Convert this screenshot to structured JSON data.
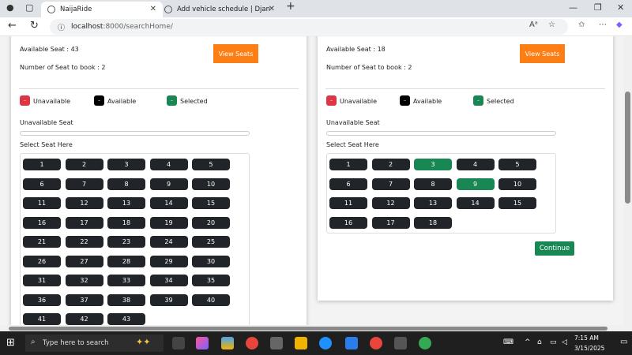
{
  "browser": {
    "tabs": [
      {
        "title": "NaijaRide"
      },
      {
        "title": "Add vehicle schedule | Django sit"
      }
    ],
    "url_host": "localhost",
    "url_path": ":8000/searchHome/"
  },
  "left_card": {
    "available_seat": "Available Seat : 43",
    "number_to_book": "Number of Seat to book : 2",
    "view_button": "View Seats",
    "legend": {
      "unavailable": "Unavailable",
      "available": "Available",
      "selected": "Selected"
    },
    "unavailable_label": "Unavailable Seat",
    "select_label": "Select Seat Here",
    "seats": [
      "1",
      "2",
      "3",
      "4",
      "5",
      "6",
      "7",
      "8",
      "9",
      "10",
      "11",
      "12",
      "13",
      "14",
      "15",
      "16",
      "17",
      "18",
      "19",
      "20",
      "21",
      "22",
      "23",
      "24",
      "25",
      "26",
      "27",
      "28",
      "29",
      "30",
      "31",
      "32",
      "33",
      "34",
      "35",
      "36",
      "37",
      "38",
      "39",
      "40",
      "41",
      "42",
      "43"
    ],
    "selected": []
  },
  "right_card": {
    "available_seat": "Available Seat : 18",
    "number_to_book": "Number of Seat to book : 2",
    "view_button": "View Seats",
    "legend": {
      "unavailable": "Unavailable",
      "available": "Available",
      "selected": "Selected"
    },
    "unavailable_label": "Unavailable Seat",
    "select_label": "Select Seat Here",
    "seats": [
      "1",
      "2",
      "3",
      "4",
      "5",
      "6",
      "7",
      "8",
      "9",
      "10",
      "11",
      "12",
      "13",
      "14",
      "15",
      "16",
      "17",
      "18"
    ],
    "selected": [
      "3",
      "9"
    ],
    "continue_button": "Continue"
  },
  "colors": {
    "unavailable": "#dc3545",
    "available": "#000000",
    "selected": "#198754",
    "view_button": "#fd7e14"
  },
  "taskbar": {
    "search_placeholder": "Type here to search",
    "time": "7:15 AM",
    "date": "3/15/2025"
  }
}
